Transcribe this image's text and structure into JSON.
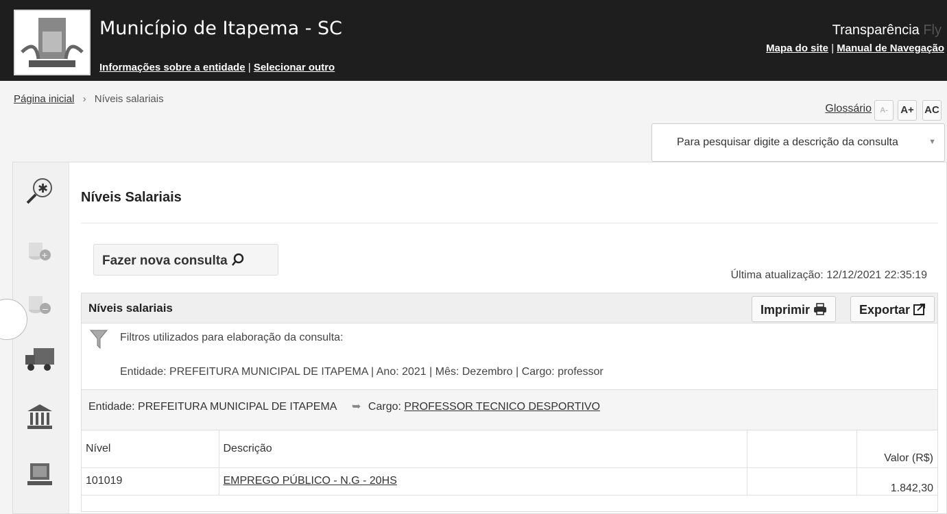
{
  "header": {
    "title": "Município de Itapema - SC",
    "info_link": "Informações sobre a entidade",
    "select_link": "Selecionar outro",
    "link_sep": "|",
    "brand": "Transparência",
    "brand_suffix": "Fly",
    "sitemap_link": "Mapa do site",
    "manual_link": "Manual de Navegação"
  },
  "breadcrumb": {
    "home": "Página inicial",
    "sep": "›",
    "current": "Níveis salariais"
  },
  "toolbar": {
    "glossary": "Glossário",
    "font_smaller": "A-",
    "font_larger": "A+",
    "contrast": "AC"
  },
  "search": {
    "placeholder": "Para pesquisar digite a descrição da consulta",
    "caret": "▼"
  },
  "page": {
    "title": "Níveis Salariais",
    "new_query": "Fazer nova consulta",
    "last_update": "Última atualização: 12/12/2021 22:35:19"
  },
  "result": {
    "title": "Níveis salariais",
    "print": "Imprimir",
    "export": "Exportar",
    "filters_label": "Filtros utilizados para elaboração da consulta:",
    "filters_value": "Entidade: PREFEITURA MUNICIPAL DE ITAPEMA | Ano: 2021 | Mês: Dezembro | Cargo: professor",
    "entity": "Entidade: PREFEITURA MUNICIPAL DE ITAPEMA",
    "cargo_label": "Cargo:",
    "cargo_value": "PROFESSOR TECNICO DESPORTIVO"
  },
  "table": {
    "headers": [
      "Nível",
      "Descrição",
      "",
      "Valor (R$)"
    ],
    "rows": [
      {
        "nivel": "101019",
        "descricao": "EMPREGO PÚBLICO - N.G - 20HS",
        "valor": "1.842,30"
      }
    ]
  },
  "icons": [
    "search-star-icon",
    "coins-add-icon",
    "coins-remove-icon",
    "truck-icon",
    "bank-icon",
    "computer-icon"
  ]
}
